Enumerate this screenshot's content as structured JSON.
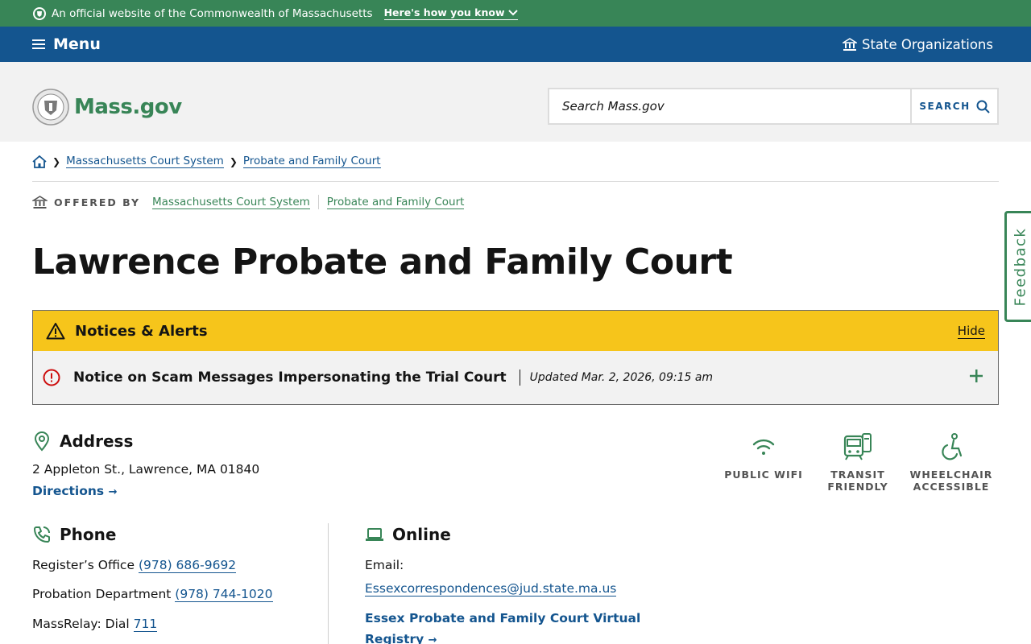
{
  "official_banner": {
    "text": "An official website of the Commonwealth of Massachusetts",
    "how_label": "Here's how you know"
  },
  "menubar": {
    "menu_label": "Menu",
    "orgs_label": "State Organizations"
  },
  "header": {
    "logo_text": "Mass.gov",
    "search_placeholder": "Search Mass.gov",
    "search_button": "SEARCH"
  },
  "breadcrumb": {
    "items": [
      "Massachusetts Court System",
      "Probate and Family Court"
    ]
  },
  "offered_by": {
    "label": "OFFERED BY",
    "items": [
      "Massachusetts Court System",
      "Probate and Family Court"
    ]
  },
  "feedback_label": "Feedback",
  "page_title": "Lawrence Probate and Family Court",
  "alerts": {
    "heading": "Notices & Alerts",
    "hide_label": "Hide",
    "items": [
      {
        "title": "Notice on Scam Messages Impersonating the Trial Court",
        "updated": "Updated Mar. 2, 2026, 09:15 am"
      }
    ]
  },
  "address": {
    "heading": "Address",
    "line": "2 Appleton St., Lawrence, MA 01840",
    "directions_label": "Directions"
  },
  "amenities": [
    {
      "label_1": "PUBLIC WIFI",
      "label_2": "",
      "icon": "wifi-icon"
    },
    {
      "label_1": "TRANSIT",
      "label_2": "FRIENDLY",
      "icon": "transit-icon"
    },
    {
      "label_1": "WHEELCHAIR",
      "label_2": "ACCESSIBLE",
      "icon": "wheelchair-icon"
    }
  ],
  "phone": {
    "heading": "Phone",
    "rows": [
      {
        "label": "Register’s Office",
        "value": "(978) 686-9692"
      },
      {
        "label": "Probation Department",
        "value": "(978) 744-1020"
      },
      {
        "label": "MassRelay: Dial",
        "value": "711"
      }
    ]
  },
  "online": {
    "heading": "Online",
    "email_label": "Email:",
    "email": "Essexcorrespondences@jud.state.ma.us",
    "registry_line1": "Essex Probate and Family Court Virtual",
    "registry_line2": "Registry"
  },
  "colors": {
    "green": "#388557",
    "blue": "#14558f",
    "alert_yellow": "#f6c51b",
    "alert_red": "#cd0d0d"
  }
}
